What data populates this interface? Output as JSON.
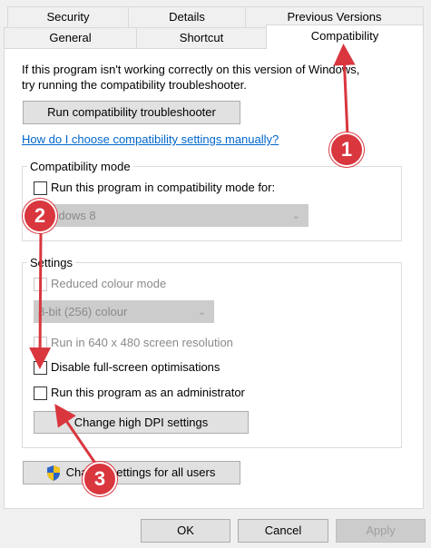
{
  "tabs": {
    "row1": [
      "Security",
      "Details",
      "Previous Versions"
    ],
    "row2": [
      "General",
      "Shortcut",
      "Compatibility"
    ]
  },
  "intro": "If this program isn't working correctly on this version of Windows, try running the compatibility troubleshooter.",
  "troubleshooter_button": "Run compatibility troubleshooter",
  "help_link": "How do I choose compatibility settings manually?",
  "compat_mode": {
    "title": "Compatibility mode",
    "checkbox_label": "Run this program in compatibility mode for:",
    "os_value": "Windows 8"
  },
  "settings": {
    "title": "Settings",
    "reduced_colour": "Reduced colour mode",
    "colour_value": "8-bit (256) colour",
    "run_640": "Run in 640 x 480 screen resolution",
    "disable_fullscreen": "Disable full-screen optimisations",
    "run_admin": "Run this program as an administrator",
    "dpi_button": "Change high DPI settings"
  },
  "all_users_button": "Change settings for all users",
  "footer": {
    "ok": "OK",
    "cancel": "Cancel",
    "apply": "Apply"
  },
  "annotations": [
    "1",
    "2",
    "3"
  ],
  "colors": {
    "annotation": "#d9363e",
    "link": "#0066cc"
  }
}
